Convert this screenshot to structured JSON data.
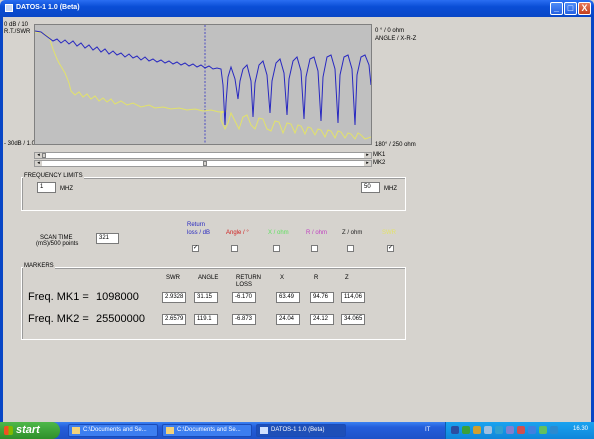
{
  "window": {
    "title": "DATOS-1 1.0 (Beta)",
    "controls": [
      "_",
      "□",
      "X"
    ]
  },
  "graph": {
    "y_left_top": "0 dB / 10",
    "y_left_top2": "R.T./SWR",
    "y_left_bottom": "- 30dB / 1.0",
    "y_right_top": "0 ° / 0 ohm",
    "y_right_top2": "ANGLE / X-R-Z",
    "y_right_bottom": "180° / 250 ohm",
    "colors": {
      "background": "#c0c0c0",
      "return_loss": "#2020c8",
      "swr": "#e2e26a",
      "marker": "#3030c0"
    }
  },
  "scrollbars": [
    {
      "label": "MK1"
    },
    {
      "label": "MK2"
    }
  ],
  "frequency_limits": {
    "title": "FREQUENCY LIMITS",
    "min_value": "1",
    "min_unit": "MHZ",
    "max_value": "50",
    "max_unit": "MHZ"
  },
  "scan": {
    "label1": "SCAN TIME",
    "label2": "(mS)/500 points",
    "value": "321"
  },
  "traces": [
    {
      "label1": "Return",
      "label2": "loss / dB",
      "color": "#2828c0",
      "checked": "✓"
    },
    {
      "label1": "",
      "label2": "Angle / °",
      "color": "#d02020",
      "checked": ""
    },
    {
      "label1": "",
      "label2": "X / ohm",
      "color": "#60e060",
      "checked": ""
    },
    {
      "label1": "",
      "label2": "R / ohm",
      "color": "#c040c0",
      "checked": ""
    },
    {
      "label1": "",
      "label2": "Z / ohm",
      "color": "#202020",
      "checked": ""
    },
    {
      "label1": "",
      "label2": "SWR",
      "color": "#e2e26a",
      "checked": "✓"
    }
  ],
  "markers": {
    "title": "MARKERS",
    "columns": [
      "SWR",
      "ANGLE",
      "RETURN",
      "X",
      "R",
      "Z"
    ],
    "column_sub": "LOSS",
    "rows": [
      {
        "label": "Freq. MK1 =",
        "freq": "1098000",
        "values": [
          "2.9328",
          "31.15",
          "-6.170",
          "63.49",
          "94.76",
          "114,06"
        ]
      },
      {
        "label": "Freq. MK2 =",
        "freq": "25500000",
        "values": [
          "2.6579",
          "119.1",
          "-6.873",
          "24.04",
          "24.12",
          "34.065"
        ]
      }
    ]
  },
  "taskbar": {
    "start": "start",
    "items": [
      "C:\\Documents and Se...",
      "C:\\Documents and Se...",
      "DATOS-1 1.0 (Beta)"
    ],
    "lang": "IT",
    "clock": "16.30"
  }
}
